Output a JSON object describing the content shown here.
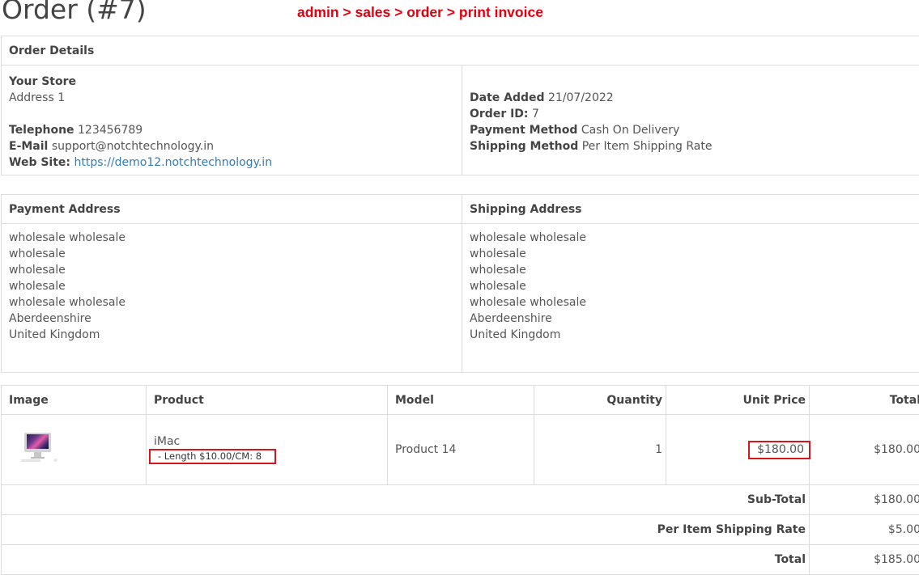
{
  "title": "Order (#7)",
  "annotation": "admin > sales > order > print invoice",
  "order_details": {
    "heading": "Order Details",
    "store_name": "Your Store",
    "store_address": "Address 1",
    "telephone_label": "Telephone",
    "telephone": "123456789",
    "email_label": "E-Mail",
    "email": "support@notchtechnology.in",
    "website_label": "Web Site:",
    "website": "https://demo12.notchtechnology.in",
    "date_added_label": "Date Added",
    "date_added": "21/07/2022",
    "order_id_label": "Order ID:",
    "order_id": "7",
    "payment_method_label": "Payment Method",
    "payment_method": "Cash On Delivery",
    "shipping_method_label": "Shipping Method",
    "shipping_method": "Per Item Shipping Rate"
  },
  "addresses": {
    "payment_heading": "Payment Address",
    "shipping_heading": "Shipping Address",
    "payment_lines": [
      "wholesale wholesale",
      "wholesale",
      "wholesale",
      "wholesale",
      "wholesale wholesale",
      "Aberdeenshire",
      "United Kingdom"
    ],
    "shipping_lines": [
      "wholesale wholesale",
      "wholesale",
      "wholesale",
      "wholesale",
      "wholesale wholesale",
      "Aberdeenshire",
      "United Kingdom"
    ]
  },
  "products": {
    "headers": {
      "image": "Image",
      "product": "Product",
      "model": "Model",
      "quantity": "Quantity",
      "unit_price": "Unit Price",
      "total": "Total"
    },
    "rows": [
      {
        "name": "iMac",
        "option": "- Length $10.00/CM: 8",
        "model": "Product 14",
        "quantity": "1",
        "unit_price": "$180.00",
        "total": "$180.00"
      }
    ],
    "totals": [
      {
        "label": "Sub-Total",
        "value": "$180.00"
      },
      {
        "label": "Per Item Shipping Rate",
        "value": "$5.00"
      },
      {
        "label": "Total",
        "value": "$185.00"
      }
    ]
  },
  "colors": {
    "annotation": "#e2000e",
    "highlight_border": "#d9151c",
    "link": "#337ab7"
  }
}
